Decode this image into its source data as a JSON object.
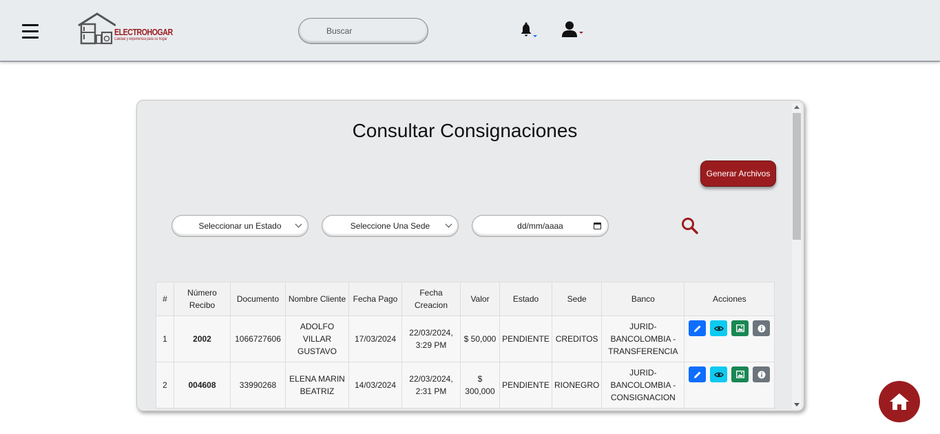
{
  "header": {
    "brand_name": "ELECTROHOGAR",
    "brand_tagline": "Calidad y experiencia para su hogar",
    "search_placeholder": "Buscar",
    "icons": [
      "menu-icon",
      "bell-icon",
      "user-icon"
    ]
  },
  "page": {
    "title": "Consultar Consignaciones",
    "generate_button": "Generar Archivos"
  },
  "filters": {
    "estado_selected": "Seleccionar un Estado",
    "sede_selected": "Seleccione Una Sede",
    "fecha_value": "dd/mm/aaaa"
  },
  "table": {
    "headers": [
      "#",
      "Número Recibo",
      "Documento",
      "Nombre Cliente",
      "Fecha Pago",
      "Fecha Creacion",
      "Valor",
      "Estado",
      "Sede",
      "Banco",
      "Acciones"
    ],
    "rows": [
      {
        "num": "1",
        "recibo": "2002",
        "documento": "1066727606",
        "cliente": "ADOLFO VILLAR GUSTAVO",
        "fecha_pago": "17/03/2024",
        "fecha_creacion": "22/03/2024, 3:29 PM",
        "valor": "$ 50,000",
        "estado": "PENDIENTE",
        "sede": "CREDITOS",
        "banco": "JURID- BANCOLOMBIA - TRANSFERENCIA"
      },
      {
        "num": "2",
        "recibo": "004608",
        "documento": "33990268",
        "cliente": "ELENA MARIN BEATRIZ",
        "fecha_pago": "14/03/2024",
        "fecha_creacion": "22/03/2024, 2:31 PM",
        "valor": "$ 300,000",
        "estado": "PENDIENTE",
        "sede": "RIONEGRO",
        "banco": "JURID- BANCOLOMBIA - CONSIGNACION"
      }
    ]
  },
  "colors": {
    "brand": "#9b1c1f",
    "edit": "#0d6efd",
    "view": "#0dcaf0",
    "image": "#198754",
    "info": "#6c757d"
  }
}
